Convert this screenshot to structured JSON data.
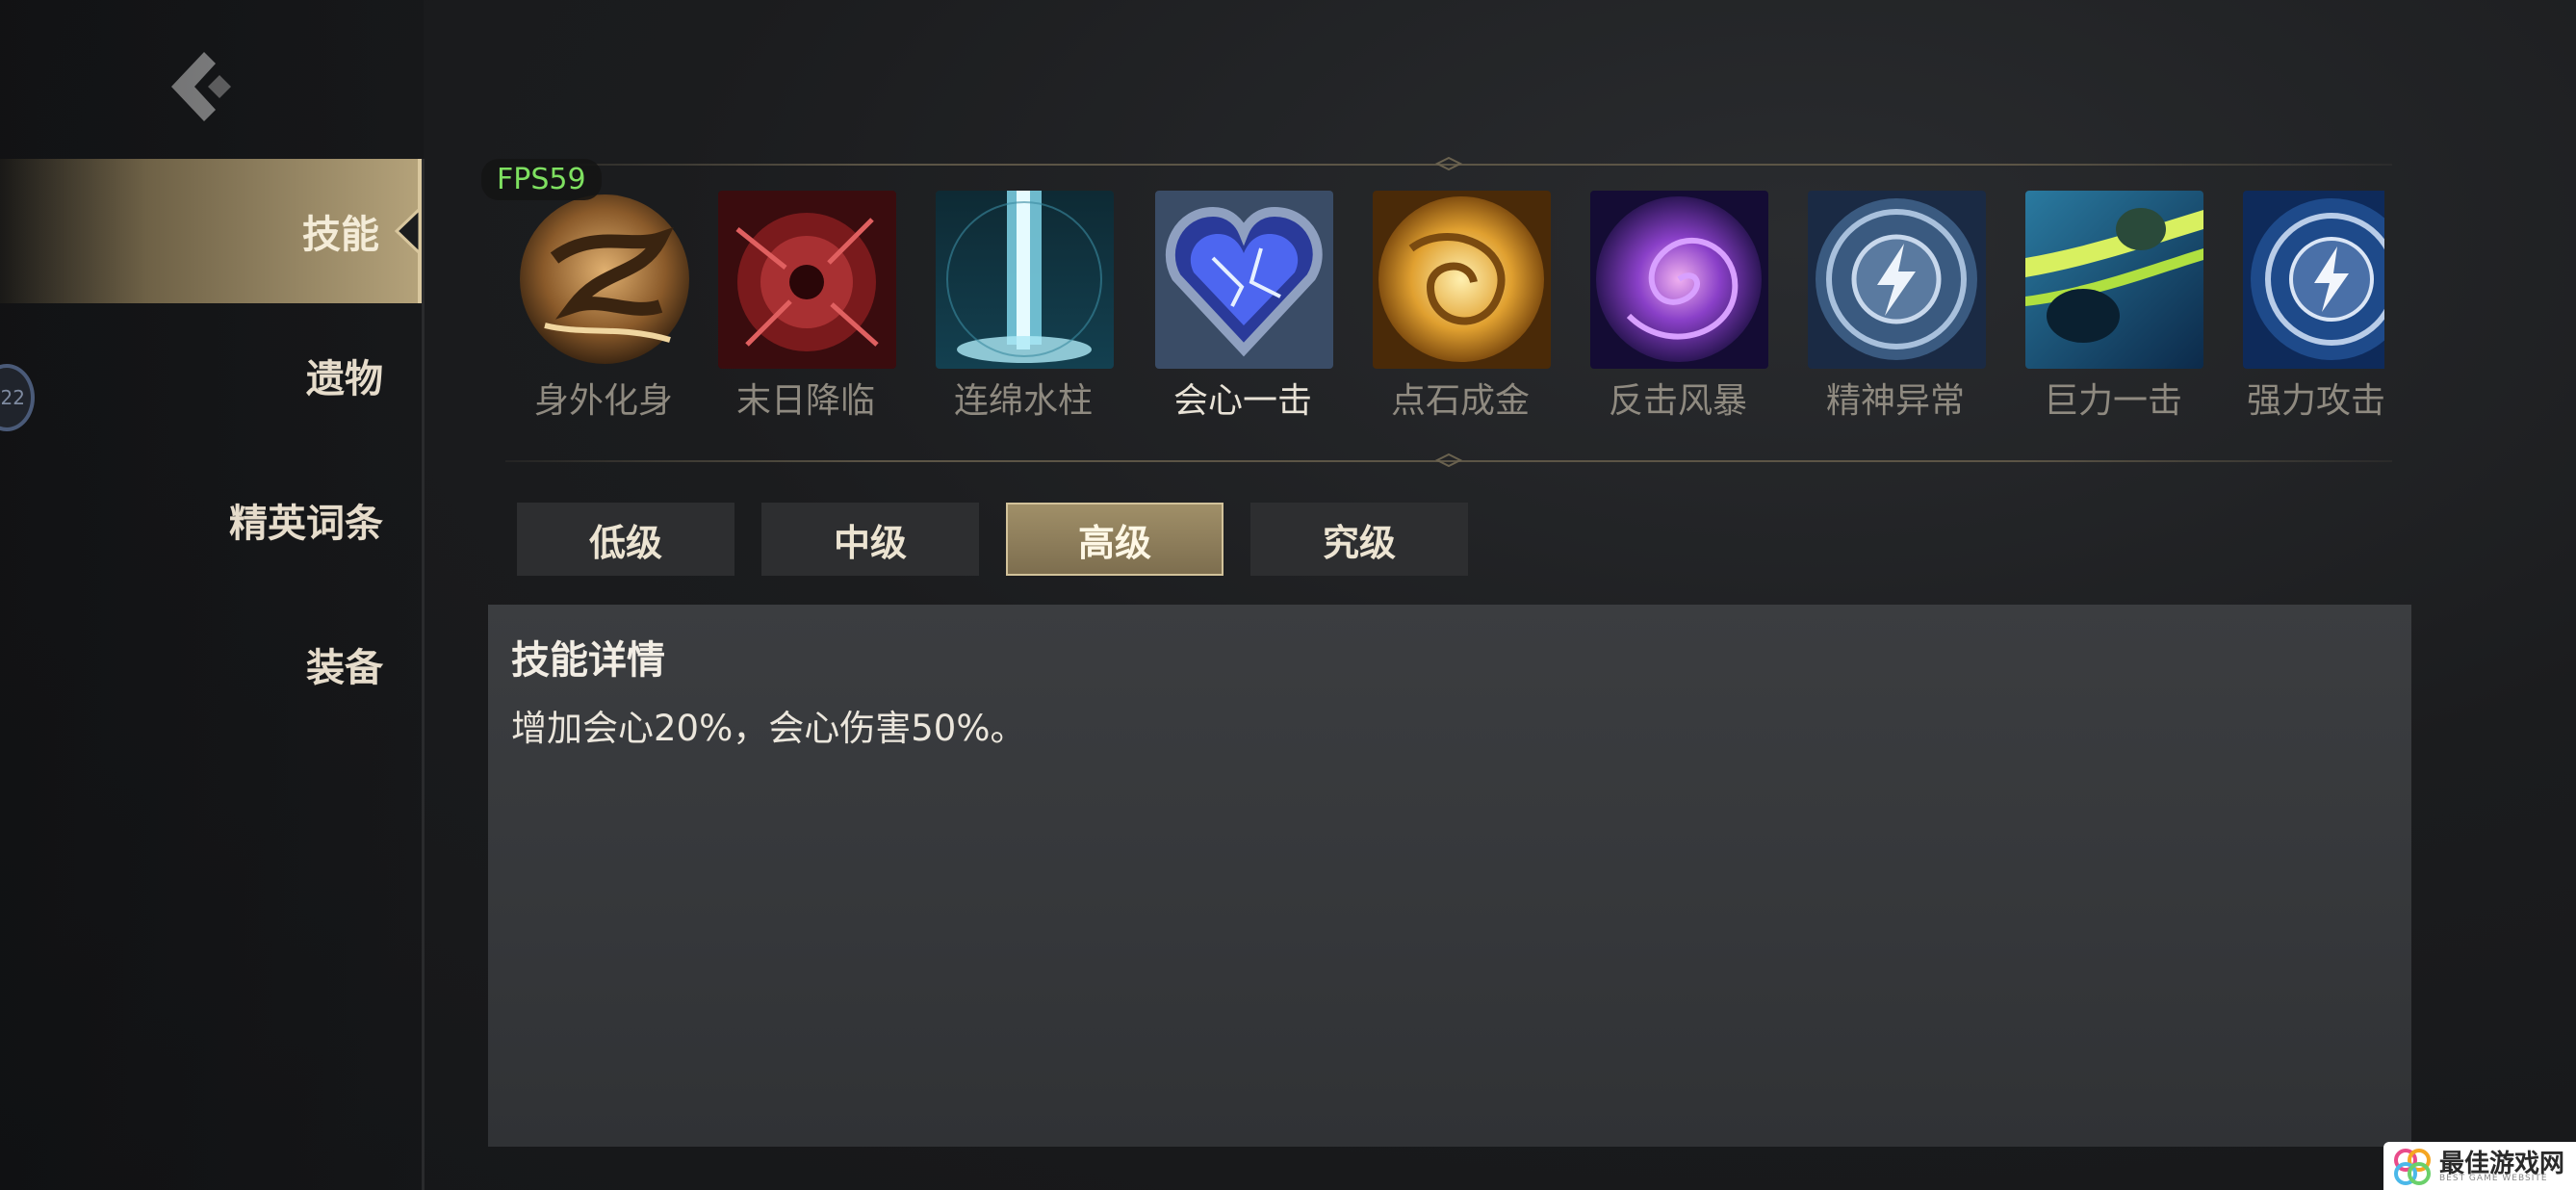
{
  "overlay": {
    "fps": "FPS59"
  },
  "sidebar": {
    "items": [
      {
        "label": "技能",
        "active": true
      },
      {
        "label": "遗物",
        "active": false
      },
      {
        "label": "精英词条",
        "active": false
      },
      {
        "label": "装备",
        "active": false
      }
    ],
    "edge_badge": "22"
  },
  "skills": [
    {
      "name": "身外化身",
      "icon": "doppelganger-icon"
    },
    {
      "name": "末日降临",
      "icon": "doom-meteor-icon"
    },
    {
      "name": "连绵水柱",
      "icon": "water-pillar-icon"
    },
    {
      "name": "会心一击",
      "icon": "crystal-heart-icon",
      "selected": true
    },
    {
      "name": "点石成金",
      "icon": "golden-swirl-icon"
    },
    {
      "name": "反击风暴",
      "icon": "purple-vortex-icon"
    },
    {
      "name": "精神异常",
      "icon": "lightning-shield-icon"
    },
    {
      "name": "巨力一击",
      "icon": "power-strike-icon"
    },
    {
      "name": "强力攻击",
      "icon": "lightning-fist-icon"
    }
  ],
  "tiers": [
    {
      "label": "低级",
      "active": false
    },
    {
      "label": "中级",
      "active": false
    },
    {
      "label": "高级",
      "active": true
    },
    {
      "label": "究级",
      "active": false
    }
  ],
  "detail": {
    "title": "技能详情",
    "text": "增加会心20%，会心伤害50%。"
  },
  "watermark": {
    "title": "最佳游戏网",
    "subtitle": "BEST GAME WEBSITE"
  },
  "colors": {
    "accent_gold": "#b4a27a",
    "fps_green": "#7ee060",
    "panel": "#393b3e"
  }
}
